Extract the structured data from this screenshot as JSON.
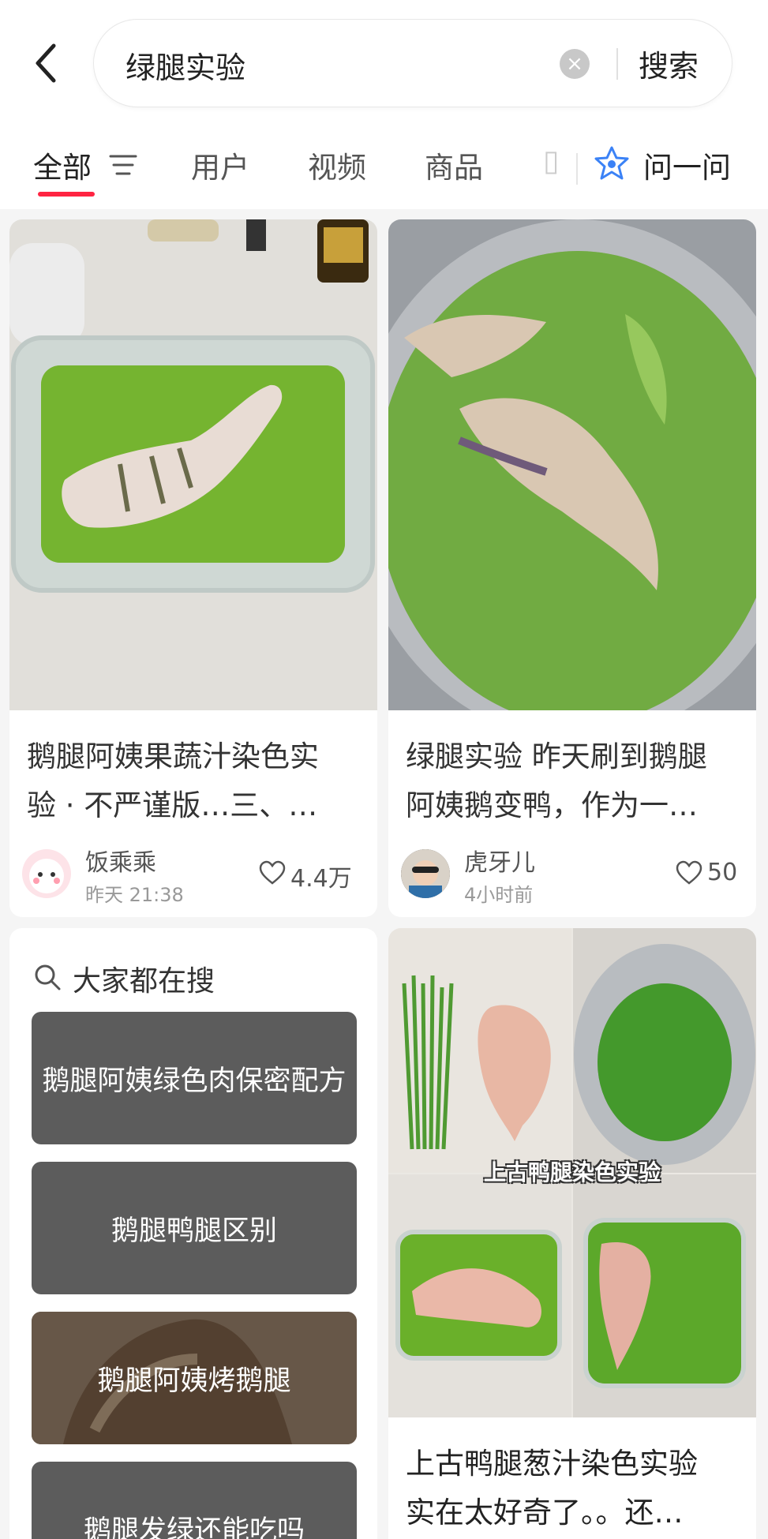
{
  "search": {
    "query": "绿腿实验",
    "search_button": "搜索"
  },
  "tabs": {
    "items": [
      "全部",
      "用户",
      "视频",
      "商品"
    ],
    "ask": "问一问"
  },
  "feed": [
    {
      "title_line1": "鹅腿阿姨果蔬汁染色实",
      "title_line2": "验 · 不严谨版…三、…",
      "author": "饭乘乘",
      "time": "昨天 21:38",
      "likes": "4.4万"
    },
    {
      "title_line1": "绿腿实验 昨天刷到鹅腿",
      "title_line2": "阿姨鹅变鸭，作为一…",
      "author": "虎牙儿",
      "time": "4小时前",
      "likes": "50"
    },
    {
      "title_line1": "上古鸭腿葱汁染色实验",
      "title_line2": "实在太好奇了。。还…",
      "image_caption": "上古鸭腿染色实验"
    }
  ],
  "trending": {
    "heading": "大家都在搜",
    "items": [
      "鹅腿阿姨绿色肉保密配方",
      "鹅腿鸭腿区别",
      "鹅腿阿姨烤鹅腿",
      "鹅腿发绿还能吃吗"
    ]
  },
  "colors": {
    "accent": "#ff2442",
    "trend_bg": "#5c5c5c",
    "marinade_green": "#6aa82a"
  }
}
